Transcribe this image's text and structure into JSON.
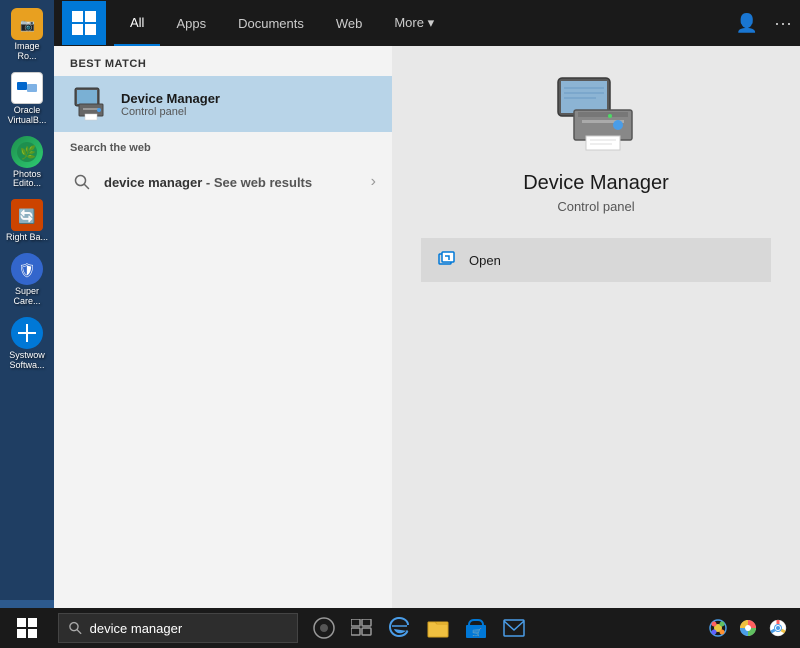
{
  "nav": {
    "tabs": [
      {
        "id": "all",
        "label": "All",
        "active": true
      },
      {
        "id": "apps",
        "label": "Apps"
      },
      {
        "id": "documents",
        "label": "Documents"
      },
      {
        "id": "web",
        "label": "Web"
      },
      {
        "id": "more",
        "label": "More ▾"
      }
    ],
    "right_icons": [
      "person-icon",
      "ellipsis-icon"
    ]
  },
  "left_panel": {
    "best_match_label": "Best match",
    "result": {
      "title": "Device Manager",
      "subtitle": "Control panel"
    },
    "search_web_label": "Search the web",
    "web_search": {
      "query": "device manager",
      "link_text": "- See web results"
    }
  },
  "right_panel": {
    "title": "Device Manager",
    "subtitle": "Control panel",
    "actions": [
      {
        "label": "Open"
      }
    ]
  },
  "taskbar": {
    "search_placeholder": "device manager",
    "search_query": "device manager"
  },
  "desktop_icons": [
    {
      "label": "Image Ro...",
      "color": "#e8a020"
    },
    {
      "label": "Oracle VirtualB...",
      "color": "#0066cc"
    },
    {
      "label": "Photos Edito...",
      "color": "#1e8f4e"
    },
    {
      "label": "Right Ba...",
      "color": "#cc4400"
    },
    {
      "label": "Super Care...",
      "color": "#3366cc"
    },
    {
      "label": "Systwow Softwa...",
      "color": "#0078d7"
    }
  ]
}
